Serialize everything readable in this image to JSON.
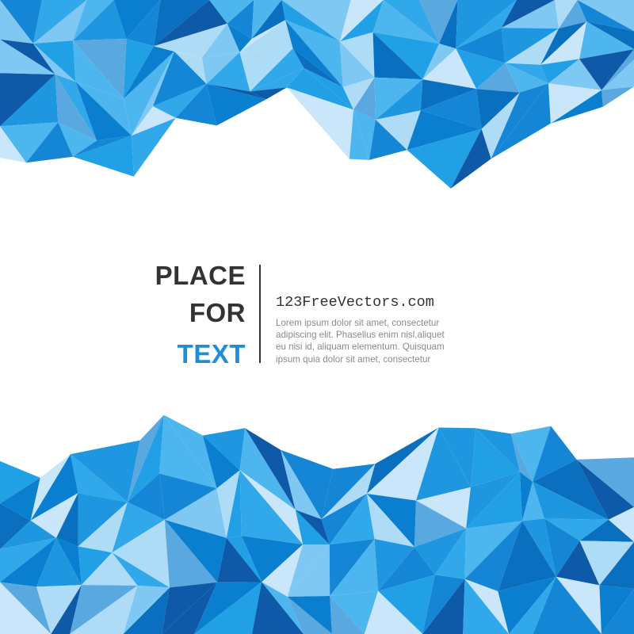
{
  "headline": [
    "PLACE",
    "FOR",
    "TEXT"
  ],
  "site": "123FreeVectors.com",
  "body_text": "Lorem ipsum dolor sit amet, consectetur\nadipiscing elit. Phasellus enim nisl,aliquet\neu nisi id, aliquam elementum. Quisquam\nipsum quia dolor sit amet, consectetur",
  "colors": {
    "headline_dark": "#333333",
    "headline_accent": "#1e8fd6",
    "body_text": "#8a8a8a",
    "divider": "#333333",
    "polygon_palette": [
      "#0b6fc0",
      "#1585d6",
      "#1f97e0",
      "#31a8ea",
      "#4db6ef",
      "#7ec8f3",
      "#aedcf7",
      "#0e5aa8",
      "#22a0e6",
      "#0a7fd0",
      "#5aa8e0",
      "#c9e6fa"
    ]
  }
}
